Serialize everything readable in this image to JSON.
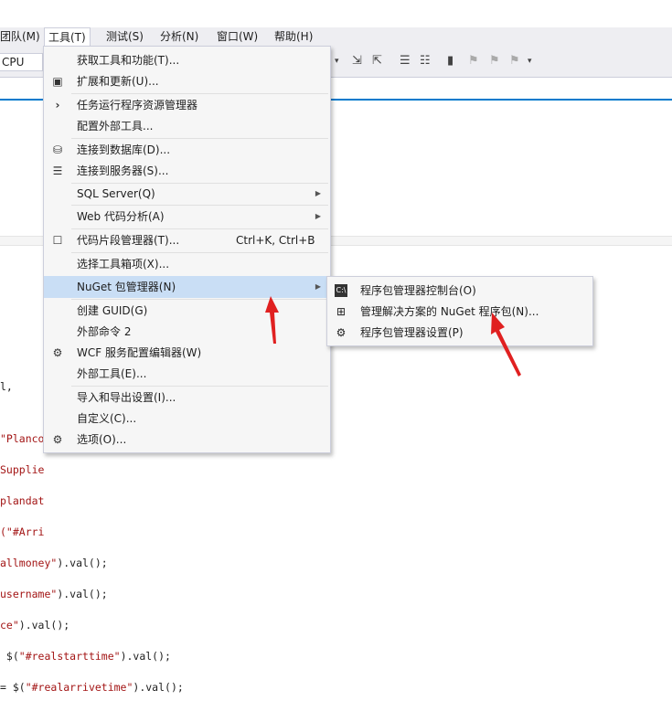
{
  "menubar": {
    "items": [
      {
        "label": "团队(M)"
      },
      {
        "label": "工具(T)"
      },
      {
        "label": "测试(S)"
      },
      {
        "label": "分析(N)"
      },
      {
        "label": "窗口(W)"
      },
      {
        "label": "帮助(H)"
      }
    ]
  },
  "toolbar": {
    "platform": "CPU"
  },
  "tools_menu": {
    "items": [
      {
        "label": "获取工具和功能(T)..."
      },
      {
        "label": "扩展和更新(U)..."
      },
      {
        "label": "任务运行程序资源管理器"
      },
      {
        "label": "配置外部工具..."
      },
      {
        "label": "连接到数据库(D)..."
      },
      {
        "label": "连接到服务器(S)..."
      },
      {
        "label": "SQL Server(Q)"
      },
      {
        "label": "Web 代码分析(A)"
      },
      {
        "label": "代码片段管理器(T)...",
        "shortcut": "Ctrl+K, Ctrl+B"
      },
      {
        "label": "选择工具箱项(X)..."
      },
      {
        "label": "NuGet 包管理器(N)"
      },
      {
        "label": "创建 GUID(G)"
      },
      {
        "label": "外部命令 2"
      },
      {
        "label": "WCF 服务配置编辑器(W)"
      },
      {
        "label": "外部工具(E)..."
      },
      {
        "label": "导入和导出设置(I)..."
      },
      {
        "label": "自定义(C)..."
      },
      {
        "label": "选项(O)..."
      }
    ]
  },
  "nuget_submenu": {
    "items": [
      {
        "label": "程序包管理器控制台(O)"
      },
      {
        "label": "管理解决方案的 NuGet 程序包(N)..."
      },
      {
        "label": "程序包管理器设置(P)"
      }
    ]
  },
  "code": {
    "lines": [
      {
        "pre": "l,",
        "str": "",
        "post": ""
      },
      {
        "pre": "",
        "str": "\"Plancod",
        "post": ""
      },
      {
        "pre": "",
        "str": "Supplie",
        "post": ""
      },
      {
        "pre": "",
        "str": "plandat",
        "post": ""
      },
      {
        "pre": "",
        "str": "(\"#Arri",
        "post": ""
      },
      {
        "pre": "",
        "str": "allmoney\"",
        "post": ").val();"
      },
      {
        "pre": "",
        "str": "username\"",
        "post": ").val();"
      },
      {
        "pre": "",
        "str": "ce\"",
        "post": ").val();"
      },
      {
        "pre": " $(",
        "str": "\"#realstarttime\"",
        "post": ").val();"
      },
      {
        "pre": "= $(",
        "str": "\"#realarrivetime\"",
        "post": ").val();"
      }
    ]
  }
}
